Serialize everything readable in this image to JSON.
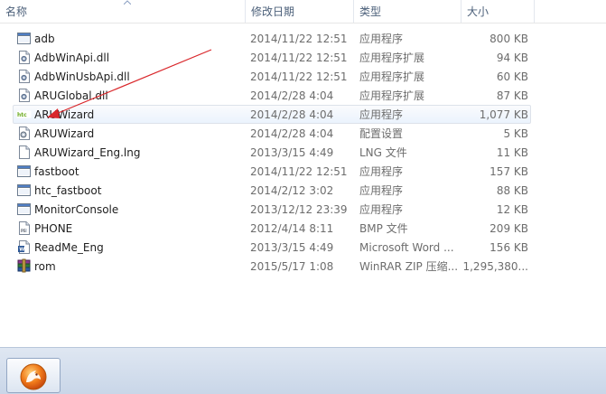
{
  "columns": {
    "name": "名称",
    "date": "修改日期",
    "type": "类型",
    "size": "大小"
  },
  "files": [
    {
      "name": "adb",
      "date": "2014/11/22 12:51",
      "type": "应用程序",
      "size": "800 KB",
      "icon": "exe-icon"
    },
    {
      "name": "AdbWinApi.dll",
      "date": "2014/11/22 12:51",
      "type": "应用程序扩展",
      "size": "94 KB",
      "icon": "dll-icon"
    },
    {
      "name": "AdbWinUsbApi.dll",
      "date": "2014/11/22 12:51",
      "type": "应用程序扩展",
      "size": "60 KB",
      "icon": "dll-icon"
    },
    {
      "name": "ARUGlobal.dll",
      "date": "2014/2/28 4:04",
      "type": "应用程序扩展",
      "size": "87 KB",
      "icon": "dll-icon"
    },
    {
      "name": "ARUWizard",
      "date": "2014/2/28 4:04",
      "type": "应用程序",
      "size": "1,077 KB",
      "icon": "htc-app-icon"
    },
    {
      "name": "ARUWizard",
      "date": "2014/2/28 4:04",
      "type": "配置设置",
      "size": "5 KB",
      "icon": "config-icon"
    },
    {
      "name": "ARUWizard_Eng.lng",
      "date": "2013/3/15 4:49",
      "type": "LNG 文件",
      "size": "11 KB",
      "icon": "file-icon"
    },
    {
      "name": "fastboot",
      "date": "2014/11/22 12:51",
      "type": "应用程序",
      "size": "157 KB",
      "icon": "exe-icon"
    },
    {
      "name": "htc_fastboot",
      "date": "2014/2/12 3:02",
      "type": "应用程序",
      "size": "88 KB",
      "icon": "exe-icon"
    },
    {
      "name": "MonitorConsole",
      "date": "2013/12/12 23:39",
      "type": "应用程序",
      "size": "12 KB",
      "icon": "exe-icon"
    },
    {
      "name": "PHONE",
      "date": "2012/4/14 8:11",
      "type": "BMP 文件",
      "size": "209 KB",
      "icon": "bmp-icon"
    },
    {
      "name": "ReadMe_Eng",
      "date": "2013/3/15 4:49",
      "type": "Microsoft Word ...",
      "size": "156 KB",
      "icon": "word-doc-icon"
    },
    {
      "name": "rom",
      "date": "2015/5/17 1:08",
      "type": "WinRAR ZIP 压缩...",
      "size": "1,295,380...",
      "icon": "winrar-icon"
    }
  ],
  "selected_index": 4,
  "taskbar": {
    "app_icon": "fox-app-icon"
  }
}
